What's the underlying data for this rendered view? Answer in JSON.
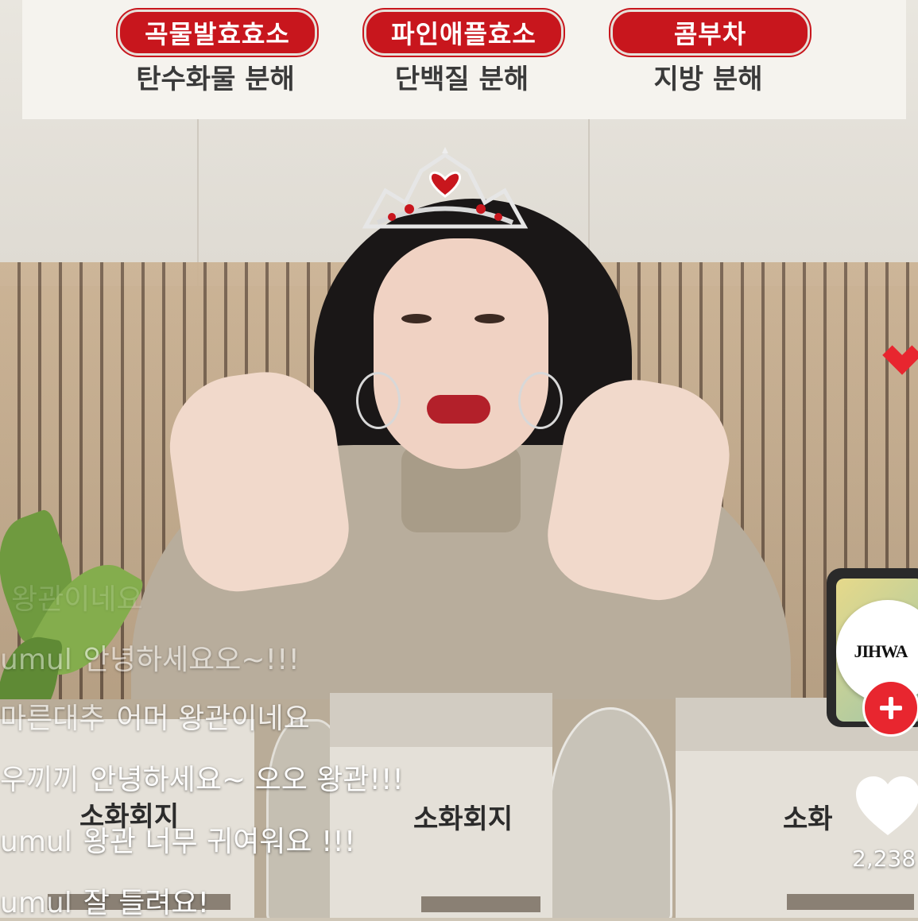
{
  "banner": {
    "items": [
      {
        "pill": "곡물발효효소",
        "caption": "탄수화물 분해"
      },
      {
        "pill": "파인애플효소",
        "caption": "단백질 분해"
      },
      {
        "pill": "콤부차",
        "caption": "지방 분해"
      }
    ]
  },
  "products": {
    "label_left": "소화회지",
    "label_center": "소화회지",
    "label_right": "소화"
  },
  "comments": [
    {
      "user": "",
      "text": "왕관이네요"
    },
    {
      "user": "umul",
      "text": "안녕하세요오~!!!"
    },
    {
      "user": "마른대추",
      "text": "어머 왕관이네요"
    },
    {
      "user": "우끼끼",
      "text": "안녕하세요~ 오오 왕관!!!"
    },
    {
      "user": "umul",
      "text": "왕관 너무 귀여워요 !!!"
    },
    {
      "user": "umul",
      "text": "잘 들려요!"
    }
  ],
  "sidebar": {
    "avatar_brand": "JIHWA",
    "follow_icon": "plus-icon",
    "like_icon": "heart-icon",
    "like_count": "2,238"
  },
  "colors": {
    "accent_red": "#c8161d",
    "follow_red": "#e8262f"
  }
}
